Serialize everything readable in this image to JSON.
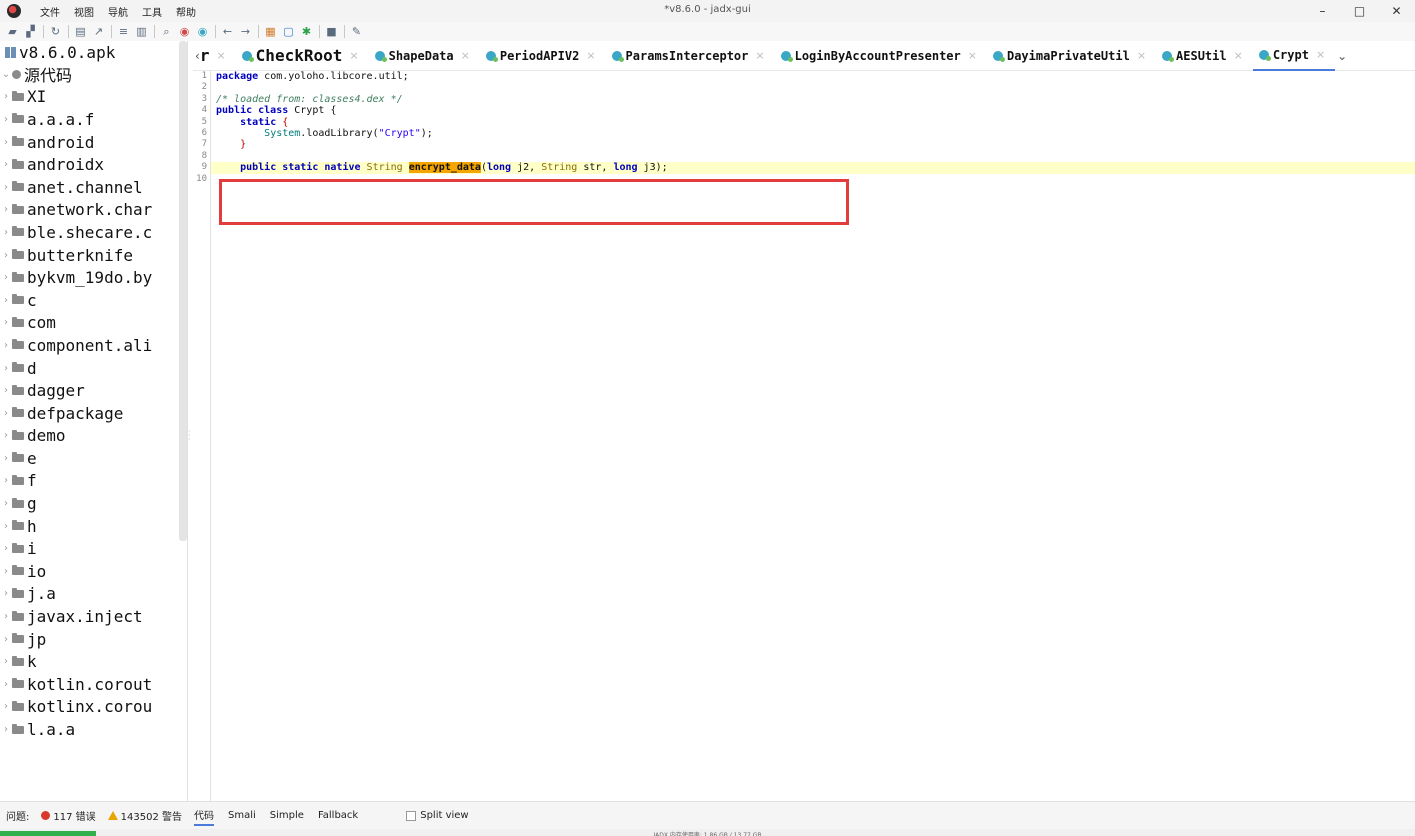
{
  "window": {
    "title": "*v8.6.0 - jadx-gui",
    "menu": [
      "文件",
      "视图",
      "导航",
      "工具",
      "帮助"
    ],
    "controls": [
      "–",
      "□",
      "✕"
    ]
  },
  "toolbar": {
    "icons": [
      "folder-open-icon",
      "add-files-icon",
      "reload-icon",
      "save-icon",
      "export-icon",
      "sync-icon",
      "flatten-icon",
      "search-icon",
      "find-class-icon",
      "find-usage-icon",
      "back-icon",
      "forward-icon",
      "deobfuscation-icon",
      "log-icon",
      "debug-icon",
      "console-icon",
      "settings-icon"
    ]
  },
  "sidebar": {
    "root": "v8.6.0.apk",
    "source_node": "源代码",
    "packages": [
      "XI",
      "a.a.a.f",
      "android",
      "androidx",
      "anet.channel",
      "anetwork.char",
      "ble.shecare.c",
      "butterknife",
      "bykvm_19do.by",
      "c",
      "com",
      "component.ali",
      "d",
      "dagger",
      "defpackage",
      "demo",
      "e",
      "f",
      "g",
      "h",
      "i",
      "io",
      "j.a",
      "javax.inject",
      "jp",
      "k",
      "kotlin.corout",
      "kotlinx.corou",
      "l.a.a"
    ]
  },
  "tabs": [
    {
      "label": "r",
      "big": true,
      "icon": false
    },
    {
      "label": "CheckRoot",
      "big": true,
      "icon": true
    },
    {
      "label": "ShapeData",
      "big": false,
      "icon": true
    },
    {
      "label": "PeriodAPIV2",
      "big": false,
      "icon": true
    },
    {
      "label": "ParamsInterceptor",
      "big": false,
      "icon": true
    },
    {
      "label": "LoginByAccountPresenter",
      "big": false,
      "icon": true
    },
    {
      "label": "DayimaPrivateUtil",
      "big": false,
      "icon": true
    },
    {
      "label": "AESUtil",
      "big": false,
      "icon": true
    },
    {
      "label": "Crypt",
      "big": false,
      "icon": true,
      "active": true
    }
  ],
  "editor": {
    "line_numbers": [
      "1",
      "2",
      "3",
      "4",
      "5",
      "6",
      "7",
      "8",
      "9",
      "10"
    ],
    "current_line": 9,
    "code": {
      "l1_kw": "package",
      "l1_rest": " com.yoloho.libcore.util;",
      "l3_comment": "/* loaded from: classes4.dex */",
      "l4_kw": "public class",
      "l4_rest": " Crypt {",
      "l5_kw": "static",
      "l5_rest": " {",
      "l6_call": "System",
      "l6_mid": ".loadLibrary(",
      "l6_str": "\"Crypt\"",
      "l6_end": ");",
      "l7": "    }",
      "l9_kw": "public static native",
      "l9_type": "String",
      "l9_method": "encrypt_data",
      "l9_p1kw": "long",
      "l9_p1": " j2, ",
      "l9_p2type": "String",
      "l9_p2": " str, ",
      "l9_p3kw": "long",
      "l9_p3": " j3);"
    }
  },
  "bottom": {
    "issues_label": "问题:",
    "errors": "117 错误",
    "warnings": "143502 警告",
    "view_tabs": [
      "代码",
      "Smali",
      "Simple",
      "Fallback"
    ],
    "split_view": "Split view",
    "memory": "JADX 内存使用率: 1.86 GB / 13.77 GB"
  },
  "colors": {
    "highlight": "#f5a500",
    "annotation_box": "#e23c3c",
    "current_line": "#ffffc8",
    "progress": "#2fb04a"
  }
}
